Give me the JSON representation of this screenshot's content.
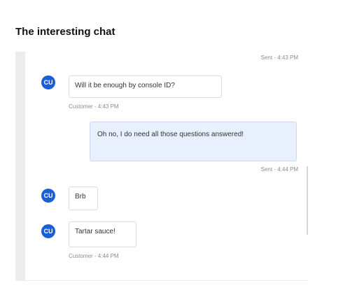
{
  "page_title": "The interesting chat",
  "messages": [
    {
      "meta": "Sent - 4:43 PM"
    },
    {
      "avatar": "CU",
      "text": "Will it be enough by console ID?",
      "meta": "Customer - 4:43 PM"
    },
    {
      "text": "Oh no, I do need all those questions answered!",
      "meta": "Sent - 4:44 PM"
    },
    {
      "avatar": "CU",
      "text": "Brb"
    },
    {
      "avatar": "CU",
      "text": "Tartar sauce!",
      "meta": "Customer - 4:44 PM"
    }
  ]
}
